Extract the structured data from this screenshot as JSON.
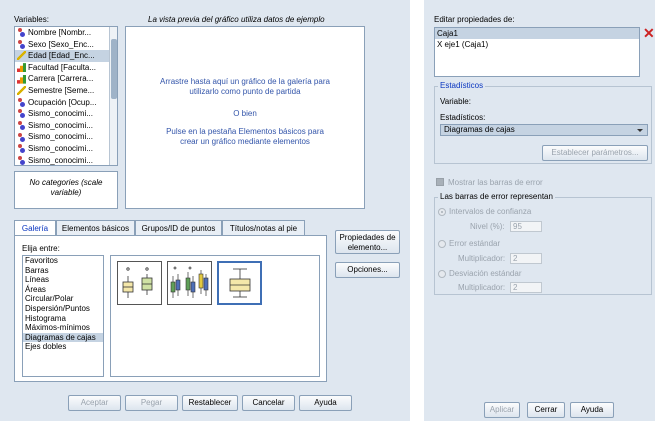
{
  "left": {
    "variables_label": "Variables:",
    "preview_note": "La vista previa del gráfico utiliza datos de ejemplo",
    "variables": [
      {
        "label": "Nombre [Nombr...",
        "icon": "nominal-icon"
      },
      {
        "label": "Sexo [Sexo_Enc...",
        "icon": "nominal-icon"
      },
      {
        "label": "Edad [Edad_Enc...",
        "icon": "scale-icon",
        "selected": true
      },
      {
        "label": "Facultad [Faculta...",
        "icon": "ordinal-icon"
      },
      {
        "label": "Carrera [Carrera...",
        "icon": "ordinal-icon"
      },
      {
        "label": "Semestre [Seme...",
        "icon": "scale-icon"
      },
      {
        "label": "Ocupación [Ocup...",
        "icon": "nominal-icon"
      },
      {
        "label": "Sismo_conocimi...",
        "icon": "nominal-icon"
      },
      {
        "label": "Sismo_conocimi...",
        "icon": "nominal-icon"
      },
      {
        "label": "Sismo_conocimi...",
        "icon": "nominal-icon"
      },
      {
        "label": "Sismo_conocimi...",
        "icon": "nominal-icon"
      },
      {
        "label": "Sismo_conocimi...",
        "icon": "nominal-icon"
      }
    ],
    "no_categories": "No categories (scale variable)",
    "canvas": {
      "line1": "Arrastre hasta aquí un gráfico de la galería para",
      "line2": "utilizarlo como punto de partida",
      "line3": "O bien",
      "line4": "Pulse en la pestaña Elementos básicos para",
      "line5": "crear un gráfico mediante elementos"
    },
    "tabs": [
      "Galería",
      "Elementos básicos",
      "Grupos/ID de puntos",
      "Títulos/notas al pie"
    ],
    "choose_label": "Elija entre:",
    "chart_types": [
      "Favoritos",
      "Barras",
      "Líneas",
      "Áreas",
      "Circular/Polar",
      "Dispersión/Puntos",
      "Histograma",
      "Máximos-mínimos",
      "Diagramas de cajas",
      "Ejes dobles"
    ],
    "selected_chart_type": "Diagramas de cajas",
    "side_buttons": {
      "properties": "Propiedades de elemento...",
      "options": "Opciones..."
    },
    "bottom_buttons": {
      "accept": "Aceptar",
      "paste": "Pegar",
      "reset": "Restablecer",
      "cancel": "Cancelar",
      "help": "Ayuda"
    }
  },
  "right": {
    "edit_props_label": "Editar propiedades de:",
    "props_list": [
      "Caja1",
      "X eje1 (Caja1)"
    ],
    "stats_legend": "Estadísticos",
    "variable_label": "Variable:",
    "stats_label": "Estadísticos:",
    "stats_value": "Diagramas de cajas",
    "set_params_button": "Establecer parámetros...",
    "show_error_bars": "Mostrar las barras de error",
    "error_bars_legend": "Las barras de error representan",
    "conf_intervals": "Intervalos de confianza",
    "level_label": "Nivel (%):",
    "level_value": "95",
    "std_error": "Error estándar",
    "multiplier_label": "Multiplicador:",
    "multiplier1_value": "2",
    "std_dev": "Desviación estándar",
    "multiplier2_value": "2",
    "buttons": {
      "apply": "Aplicar",
      "close": "Cerrar",
      "help": "Ayuda"
    }
  },
  "colors": {
    "panel": "#dfe7f0",
    "accent": "#0a36c0",
    "close_x": "#cc2222",
    "selection": "#c5d3e2"
  }
}
